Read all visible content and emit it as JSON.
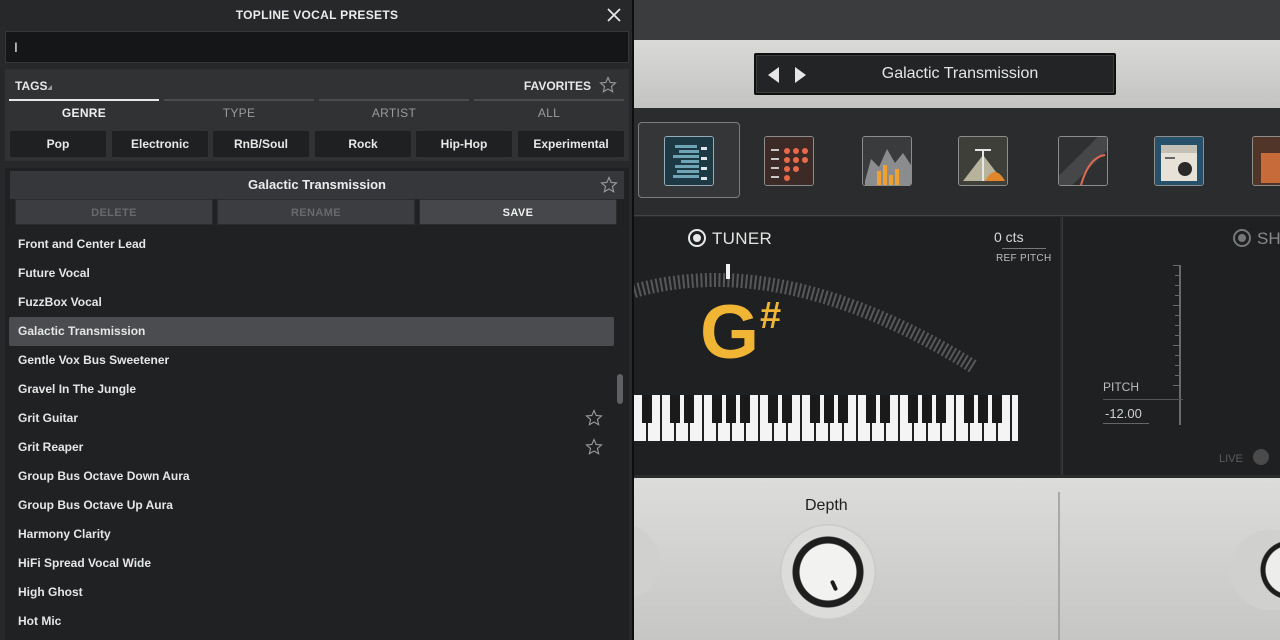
{
  "browser": {
    "title": "TOPLINE VOCAL PRESETS",
    "search_value": "I",
    "tags_label": "TAGS",
    "favorites_label": "FAVORITES",
    "tabs": [
      "GENRE",
      "TYPE",
      "ARTIST",
      "ALL"
    ],
    "active_tab": "GENRE",
    "genres": [
      "Pop",
      "Electronic",
      "RnB/Soul",
      "Rock",
      "Hip-Hop",
      "Experimental"
    ],
    "current_preset": "Galactic Transmission",
    "actions": {
      "delete": "DELETE",
      "rename": "RENAME",
      "save": "SAVE"
    },
    "presets": [
      {
        "name": "Front and Center Lead",
        "selected": false,
        "favorite": false
      },
      {
        "name": "Future Vocal",
        "selected": false,
        "favorite": false
      },
      {
        "name": "FuzzBox Vocal",
        "selected": false,
        "favorite": false
      },
      {
        "name": "Galactic Transmission",
        "selected": true,
        "favorite": false
      },
      {
        "name": "Gentle Vox Bus Sweetener",
        "selected": false,
        "favorite": false
      },
      {
        "name": "Gravel In The Jungle",
        "selected": false,
        "favorite": false
      },
      {
        "name": "Grit Guitar",
        "selected": false,
        "favorite": true
      },
      {
        "name": "Grit Reaper",
        "selected": false,
        "favorite": true
      },
      {
        "name": "Group Bus Octave Down Aura",
        "selected": false,
        "favorite": false
      },
      {
        "name": "Group Bus Octave Up Aura",
        "selected": false,
        "favorite": false
      },
      {
        "name": "Harmony Clarity",
        "selected": false,
        "favorite": false
      },
      {
        "name": "HiFi Spread Vocal Wide",
        "selected": false,
        "favorite": false
      },
      {
        "name": "High Ghost",
        "selected": false,
        "favorite": false
      },
      {
        "name": "Hot Mic",
        "selected": false,
        "favorite": false
      }
    ]
  },
  "plugin": {
    "preset_name": "Galactic Transmission",
    "tuner": {
      "label": "TUNER",
      "cents": "0 cts",
      "ref_pitch_label": "REF PITCH",
      "note": "G",
      "accidental": "#"
    },
    "shift": {
      "label": "SH",
      "pitch_label": "PITCH",
      "pitch_value": "-12.00",
      "live_label": "LIVE"
    },
    "knob": {
      "label": "Depth"
    }
  },
  "colors": {
    "accent_note": "#f0b535",
    "panel_dark": "#262829",
    "selected_row": "#4a4c4f"
  }
}
